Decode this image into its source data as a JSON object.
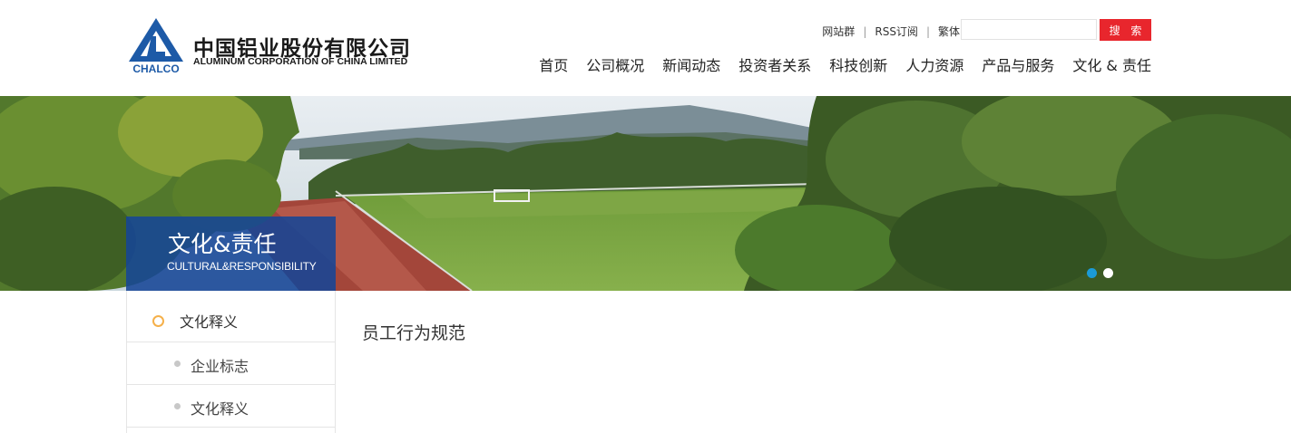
{
  "header": {
    "logo": {
      "mark_text": "CHALCO",
      "name_cn": "中国铝业股份有限公司",
      "name_en": "ALUMINUM CORPORATION OF CHINA LIMITED"
    },
    "top_links": [
      "网站群",
      "RSS订阅",
      "繁体"
    ],
    "search": {
      "value": "",
      "placeholder": "",
      "button_label": "搜 索"
    },
    "nav": [
      "首页",
      "公司概况",
      "新闻动态",
      "投资者关系",
      "科技创新",
      "人力资源",
      "产品与服务",
      "文化 & 责任"
    ]
  },
  "banner": {
    "title_cn": "文化&责任",
    "title_en": "CULTURAL&RESPONSIBILITY",
    "slide_count": 2,
    "active_slide": 1
  },
  "sidebar": {
    "heading": "文化释义",
    "items": [
      "企业标志",
      "文化释义"
    ]
  },
  "main": {
    "title": "员工行为规范"
  },
  "colors": {
    "brand_blue": "#1d5aa7",
    "search_button": "#e8262d",
    "active_dot": "#1b9bd7",
    "ring": "#f5b04a"
  }
}
